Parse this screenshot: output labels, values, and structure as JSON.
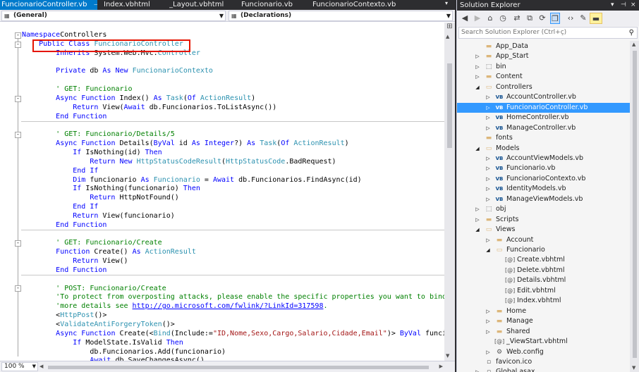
{
  "tabs": [
    {
      "label": "FuncionarioController.vb",
      "active": true,
      "pin": "⊣",
      "close": "×"
    },
    {
      "label": "Index.vbhtml",
      "active": false
    },
    {
      "label": "_Layout.vbhtml",
      "active": false
    },
    {
      "label": "Funcionario.vb",
      "active": false
    },
    {
      "label": "FuncionarioContexto.vb",
      "active": false
    }
  ],
  "nav": {
    "left_combo": "(General)",
    "right_combo": "(Declarations)"
  },
  "code_lines": [
    [
      [
        "kw",
        "Namespace"
      ],
      [
        "",
        "Controllers"
      ]
    ],
    [
      [
        "",
        "    "
      ],
      [
        "kw",
        "Public Class"
      ],
      [
        "",
        ""
      ],
      [
        "ty",
        " FuncionarioController"
      ]
    ],
    [
      [
        "",
        "        "
      ],
      [
        "kw",
        "Inherits"
      ],
      [
        "",
        " System.Web.Mvc."
      ],
      [
        "ty",
        "Controller"
      ]
    ],
    [
      [
        "",
        ""
      ]
    ],
    [
      [
        "",
        "        "
      ],
      [
        "kw",
        "Private"
      ],
      [
        "",
        " db "
      ],
      [
        "kw",
        "As New"
      ],
      [
        "ty",
        " FuncionarioContexto"
      ]
    ],
    [
      [
        "",
        ""
      ]
    ],
    [
      [
        "",
        "        "
      ],
      [
        "cm",
        "' GET: Funcionario"
      ]
    ],
    [
      [
        "",
        "        "
      ],
      [
        "kw",
        "Async Function"
      ],
      [
        "",
        " Index() "
      ],
      [
        "kw",
        "As"
      ],
      [
        "ty",
        " Task"
      ],
      [
        "",
        "("
      ],
      [
        "kw",
        "Of"
      ],
      [
        "ty",
        " ActionResult"
      ],
      [
        "",
        ")"
      ]
    ],
    [
      [
        "",
        "            "
      ],
      [
        "kw",
        "Return"
      ],
      [
        "",
        " View("
      ],
      [
        "kw",
        "Await"
      ],
      [
        "",
        " db.Funcionarios.ToListAsync())"
      ]
    ],
    [
      [
        "",
        "        "
      ],
      [
        "kw",
        "End Function"
      ]
    ],
    [
      [
        "",
        ""
      ]
    ],
    [
      [
        "",
        "        "
      ],
      [
        "cm",
        "' GET: Funcionario/Details/5"
      ]
    ],
    [
      [
        "",
        "        "
      ],
      [
        "kw",
        "Async Function"
      ],
      [
        "",
        " Details("
      ],
      [
        "kw",
        "ByVal"
      ],
      [
        "",
        " id "
      ],
      [
        "kw",
        "As Integer"
      ],
      [
        "",
        "?) "
      ],
      [
        "kw",
        "As"
      ],
      [
        "ty",
        " Task"
      ],
      [
        "",
        "("
      ],
      [
        "kw",
        "Of"
      ],
      [
        "ty",
        " ActionResult"
      ],
      [
        "",
        ")"
      ]
    ],
    [
      [
        "",
        "            "
      ],
      [
        "kw",
        "If"
      ],
      [
        "",
        " IsNothing(id) "
      ],
      [
        "kw",
        "Then"
      ]
    ],
    [
      [
        "",
        "                "
      ],
      [
        "kw",
        "Return New"
      ],
      [
        "ty",
        " HttpStatusCodeResult"
      ],
      [
        "",
        "("
      ],
      [
        "ty",
        "HttpStatusCode"
      ],
      [
        "",
        ".BadRequest)"
      ]
    ],
    [
      [
        "",
        "            "
      ],
      [
        "kw",
        "End If"
      ]
    ],
    [
      [
        "",
        "            "
      ],
      [
        "kw",
        "Dim"
      ],
      [
        "",
        " funcionario "
      ],
      [
        "kw",
        "As"
      ],
      [
        "ty",
        " Funcionario"
      ],
      [
        "",
        " = "
      ],
      [
        "kw",
        "Await"
      ],
      [
        "",
        " db.Funcionarios.FindAsync(id)"
      ]
    ],
    [
      [
        "",
        "            "
      ],
      [
        "kw",
        "If"
      ],
      [
        "",
        " IsNothing(funcionario) "
      ],
      [
        "kw",
        "Then"
      ]
    ],
    [
      [
        "",
        "                "
      ],
      [
        "kw",
        "Return"
      ],
      [
        "",
        " HttpNotFound()"
      ]
    ],
    [
      [
        "",
        "            "
      ],
      [
        "kw",
        "End If"
      ]
    ],
    [
      [
        "",
        "            "
      ],
      [
        "kw",
        "Return"
      ],
      [
        "",
        " View(funcionario)"
      ]
    ],
    [
      [
        "",
        "        "
      ],
      [
        "kw",
        "End Function"
      ]
    ],
    [
      [
        "",
        ""
      ]
    ],
    [
      [
        "",
        "        "
      ],
      [
        "cm",
        "' GET: Funcionario/Create"
      ]
    ],
    [
      [
        "",
        "        "
      ],
      [
        "kw",
        "Function"
      ],
      [
        "",
        " Create() "
      ],
      [
        "kw",
        "As"
      ],
      [
        "ty",
        " ActionResult"
      ]
    ],
    [
      [
        "",
        "            "
      ],
      [
        "kw",
        "Return"
      ],
      [
        "",
        " View()"
      ]
    ],
    [
      [
        "",
        "        "
      ],
      [
        "kw",
        "End Function"
      ]
    ],
    [
      [
        "",
        ""
      ]
    ],
    [
      [
        "",
        "        "
      ],
      [
        "cm",
        "' POST: Funcionario/Create"
      ]
    ],
    [
      [
        "",
        "        "
      ],
      [
        "cm",
        "'To protect from overposting attacks, please enable the specific properties you want to bind to, fo"
      ]
    ],
    [
      [
        "",
        "        "
      ],
      [
        "cm",
        "'more details see "
      ],
      [
        "url",
        "http://go.microsoft.com/fwlink/?LinkId=317598"
      ],
      [
        "cm",
        "."
      ]
    ],
    [
      [
        "",
        "        "
      ],
      [
        "",
        "<"
      ],
      [
        "ty",
        "HttpPost"
      ],
      [
        "",
        "()>"
      ]
    ],
    [
      [
        "",
        "        "
      ],
      [
        "",
        "<"
      ],
      [
        "ty",
        "ValidateAntiForgeryToken"
      ],
      [
        "",
        "()>"
      ]
    ],
    [
      [
        "",
        "        "
      ],
      [
        "kw",
        "Async Function"
      ],
      [
        "",
        " Create(<"
      ],
      [
        "ty",
        "Bind"
      ],
      [
        "",
        "(Include:="
      ],
      [
        "st",
        "\"ID,Nome,Sexo,Cargo,Salario,Cidade,Email\""
      ],
      [
        "",
        ")> "
      ],
      [
        "kw",
        "ByVal"
      ],
      [
        "",
        " funcionario"
      ]
    ],
    [
      [
        "",
        "            "
      ],
      [
        "kw",
        "If"
      ],
      [
        "",
        " ModelState.IsValid "
      ],
      [
        "kw",
        "Then"
      ]
    ],
    [
      [
        "",
        "                "
      ],
      [
        "",
        "db.Funcionarios.Add(funcionario)"
      ]
    ],
    [
      [
        "",
        "                "
      ],
      [
        "kw",
        "Await"
      ],
      [
        "",
        " db.SaveChangesAsync()"
      ]
    ]
  ],
  "zoom": "100 %",
  "solution_explorer": {
    "title": "Solution Explorer",
    "search_placeholder": "Search Solution Explorer (Ctrl+ç)",
    "toolbar_icons": [
      "back-icon",
      "forward-icon",
      "home-icon",
      "history-icon",
      "sync-icon",
      "collapse-all-icon",
      "show-all-files-icon",
      "view-code-icon",
      "properties-icon",
      "preview-icon"
    ],
    "tree": [
      {
        "label": "App_Data",
        "level": 2,
        "icon": "folder",
        "expander": ""
      },
      {
        "label": "App_Start",
        "level": 2,
        "icon": "folder",
        "expander": "▷"
      },
      {
        "label": "bin",
        "level": 2,
        "icon": "folder-hidden",
        "expander": "▷"
      },
      {
        "label": "Content",
        "level": 2,
        "icon": "folder",
        "expander": "▷"
      },
      {
        "label": "Controllers",
        "level": 2,
        "icon": "folder-open",
        "expander": "◢"
      },
      {
        "label": "AccountController.vb",
        "level": 3,
        "icon": "vb",
        "expander": "▷"
      },
      {
        "label": "FuncionarioController.vb",
        "level": 3,
        "icon": "vb",
        "expander": "▷",
        "selected": true
      },
      {
        "label": "HomeController.vb",
        "level": 3,
        "icon": "vb",
        "expander": "▷"
      },
      {
        "label": "ManageController.vb",
        "level": 3,
        "icon": "vb",
        "expander": "▷"
      },
      {
        "label": "fonts",
        "level": 2,
        "icon": "folder",
        "expander": ""
      },
      {
        "label": "Models",
        "level": 2,
        "icon": "folder-open",
        "expander": "◢"
      },
      {
        "label": "AccountViewModels.vb",
        "level": 3,
        "icon": "vb",
        "expander": "▷"
      },
      {
        "label": "Funcionario.vb",
        "level": 3,
        "icon": "vb",
        "expander": "▷"
      },
      {
        "label": "FuncionarioContexto.vb",
        "level": 3,
        "icon": "vb",
        "expander": "▷"
      },
      {
        "label": "IdentityModels.vb",
        "level": 3,
        "icon": "vb",
        "expander": "▷"
      },
      {
        "label": "ManageViewModels.vb",
        "level": 3,
        "icon": "vb",
        "expander": "▷"
      },
      {
        "label": "obj",
        "level": 2,
        "icon": "folder-hidden",
        "expander": "▷"
      },
      {
        "label": "Scripts",
        "level": 2,
        "icon": "folder",
        "expander": "▷"
      },
      {
        "label": "Views",
        "level": 2,
        "icon": "folder-open",
        "expander": "◢"
      },
      {
        "label": "Account",
        "level": 3,
        "icon": "folder",
        "expander": "▷"
      },
      {
        "label": "Funcionario",
        "level": 3,
        "icon": "folder-open",
        "expander": "◢"
      },
      {
        "label": "Create.vbhtml",
        "level": 4,
        "icon": "web",
        "expander": ""
      },
      {
        "label": "Delete.vbhtml",
        "level": 4,
        "icon": "web",
        "expander": ""
      },
      {
        "label": "Details.vbhtml",
        "level": 4,
        "icon": "web",
        "expander": ""
      },
      {
        "label": "Edit.vbhtml",
        "level": 4,
        "icon": "web",
        "expander": ""
      },
      {
        "label": "Index.vbhtml",
        "level": 4,
        "icon": "web",
        "expander": ""
      },
      {
        "label": "Home",
        "level": 3,
        "icon": "folder",
        "expander": "▷"
      },
      {
        "label": "Manage",
        "level": 3,
        "icon": "folder",
        "expander": "▷"
      },
      {
        "label": "Shared",
        "level": 3,
        "icon": "folder",
        "expander": "▷"
      },
      {
        "label": "_ViewStart.vbhtml",
        "level": 3,
        "icon": "web",
        "expander": ""
      },
      {
        "label": "Web.config",
        "level": 3,
        "icon": "config",
        "expander": "▷"
      },
      {
        "label": "favicon.ico",
        "level": 2,
        "icon": "file",
        "expander": ""
      },
      {
        "label": "Global.asax",
        "level": 2,
        "icon": "file",
        "expander": "▷"
      }
    ]
  },
  "colors": {
    "accent": "#007acc",
    "selection": "#3399ff",
    "highlight_box": "#e51400",
    "keyword": "#0000ff",
    "type": "#2b91af",
    "comment": "#008000",
    "string": "#a31515"
  }
}
